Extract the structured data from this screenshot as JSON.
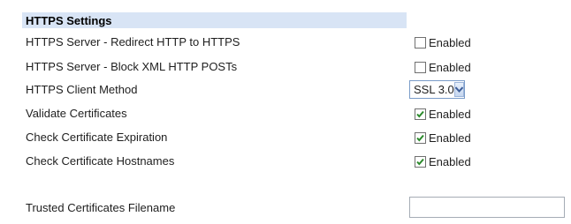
{
  "section": {
    "title": "HTTPS Settings"
  },
  "rows": [
    {
      "label": "HTTPS Server - Redirect HTTP to HTTPS",
      "control": "checkbox",
      "checked": false,
      "option_label": "Enabled"
    },
    {
      "label": "HTTPS Server - Block XML HTTP POSTs",
      "control": "checkbox",
      "checked": false,
      "option_label": "Enabled"
    },
    {
      "label": "HTTPS Client Method",
      "control": "select",
      "selected": "SSL 3.0"
    },
    {
      "label": "Validate Certificates",
      "control": "checkbox",
      "checked": true,
      "option_label": "Enabled"
    },
    {
      "label": "Check Certificate Expiration",
      "control": "checkbox",
      "checked": true,
      "option_label": "Enabled"
    },
    {
      "label": "Check Certificate Hostnames",
      "control": "checkbox",
      "checked": true,
      "option_label": "Enabled"
    },
    {
      "label": "Trusted Certificates Filename",
      "control": "text",
      "value": "",
      "placeholder": ""
    }
  ],
  "colors": {
    "section_header_bg": "#d8e4f5",
    "checkmark": "#2b8a2b",
    "select_arrow": "#3d5e99"
  },
  "icons": {
    "checkmark": "checkmark-icon",
    "dropdown": "chevron-down-icon"
  }
}
